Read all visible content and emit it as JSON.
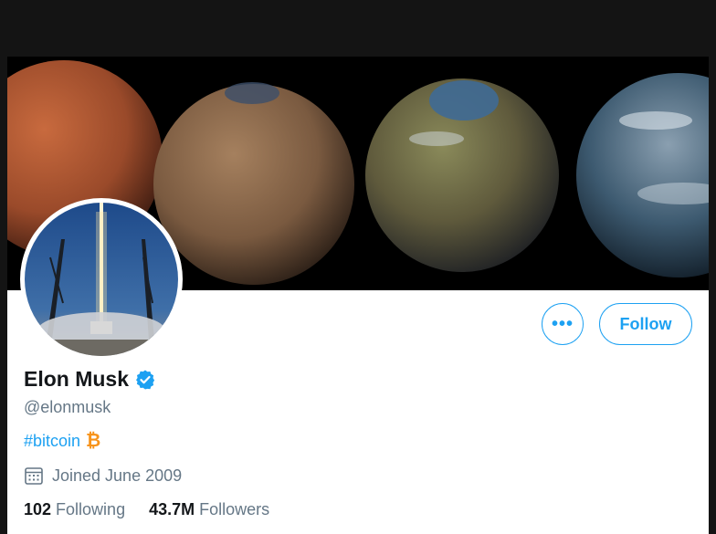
{
  "profile": {
    "display_name": "Elon Musk",
    "handle": "@elonmusk",
    "bio_hashtag": "#bitcoin",
    "bio_emoji": "₿",
    "joined": "Joined June 2009",
    "following_count": "102",
    "following_label": "Following",
    "followers_count": "43.7M",
    "followers_label": "Followers"
  },
  "actions": {
    "more_label": "•••",
    "follow_label": "Follow"
  },
  "icons": {
    "verified": "verified-badge-icon",
    "calendar": "calendar-icon",
    "bitcoin": "bitcoin-icon"
  },
  "colors": {
    "accent": "#1da1f2",
    "bitcoin": "#f7931a",
    "text_primary": "#14171a",
    "text_secondary": "#657786"
  }
}
